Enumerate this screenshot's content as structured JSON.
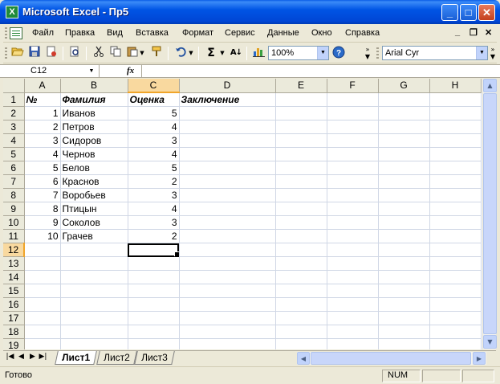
{
  "window": {
    "title": "Microsoft Excel - Пр5",
    "app_icon_letter": "X",
    "minimize": "_",
    "maximize": "□",
    "close": "✕"
  },
  "menubar": {
    "items": [
      "Файл",
      "Правка",
      "Вид",
      "Вставка",
      "Формат",
      "Сервис",
      "Данные",
      "Окно",
      "Справка"
    ],
    "doc_minimize": "_",
    "doc_restore": "❐",
    "doc_close": "✕"
  },
  "toolbar": {
    "zoom": "100%",
    "font_name": "Arial Cyr",
    "autosum": "Σ",
    "sort": "↓",
    "help": "?"
  },
  "formula_bar": {
    "name_box": "C12",
    "fx_label": "fx",
    "formula": ""
  },
  "sheet": {
    "columns": [
      "A",
      "B",
      "C",
      "D",
      "E",
      "F",
      "G",
      "H"
    ],
    "active_column": "C",
    "active_row": 12,
    "rows": [
      {
        "n": "1",
        "a": "№",
        "b": "Фамилия",
        "c": "Оценка",
        "d": "Заключение"
      },
      {
        "n": "2",
        "a": "1",
        "b": "Иванов",
        "c": "5",
        "d": ""
      },
      {
        "n": "3",
        "a": "2",
        "b": "Петров",
        "c": "4",
        "d": ""
      },
      {
        "n": "4",
        "a": "3",
        "b": "Сидоров",
        "c": "3",
        "d": ""
      },
      {
        "n": "5",
        "a": "4",
        "b": "Чернов",
        "c": "4",
        "d": ""
      },
      {
        "n": "6",
        "a": "5",
        "b": "Белов",
        "c": "5",
        "d": ""
      },
      {
        "n": "7",
        "a": "6",
        "b": "Краснов",
        "c": "2",
        "d": ""
      },
      {
        "n": "8",
        "a": "7",
        "b": "Воробьев",
        "c": "3",
        "d": ""
      },
      {
        "n": "9",
        "a": "8",
        "b": "Птицын",
        "c": "4",
        "d": ""
      },
      {
        "n": "10",
        "a": "9",
        "b": "Соколов",
        "c": "3",
        "d": ""
      },
      {
        "n": "11",
        "a": "10",
        "b": "Грачев",
        "c": "2",
        "d": ""
      },
      {
        "n": "12",
        "a": "",
        "b": "",
        "c": "",
        "d": ""
      },
      {
        "n": "13",
        "a": "",
        "b": "",
        "c": "",
        "d": ""
      },
      {
        "n": "14",
        "a": "",
        "b": "",
        "c": "",
        "d": ""
      },
      {
        "n": "15",
        "a": "",
        "b": "",
        "c": "",
        "d": ""
      },
      {
        "n": "16",
        "a": "",
        "b": "",
        "c": "",
        "d": ""
      },
      {
        "n": "17",
        "a": "",
        "b": "",
        "c": "",
        "d": ""
      },
      {
        "n": "18",
        "a": "",
        "b": "",
        "c": "",
        "d": ""
      },
      {
        "n": "19",
        "a": "",
        "b": "",
        "c": "",
        "d": ""
      }
    ]
  },
  "tabs": {
    "sheets": [
      "Лист1",
      "Лист2",
      "Лист3"
    ],
    "active": "Лист1"
  },
  "status": {
    "text": "Готово",
    "num": "NUM"
  }
}
